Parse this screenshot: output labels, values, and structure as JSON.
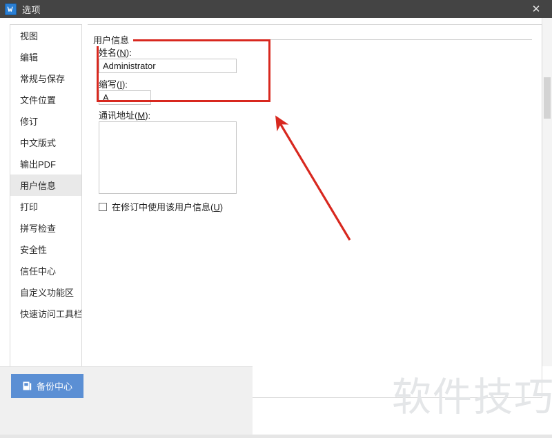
{
  "window": {
    "title": "选项",
    "app_icon": "wps-writer-icon",
    "close_label": "✕"
  },
  "sidebar": {
    "items": [
      {
        "label": "视图",
        "active": false
      },
      {
        "label": "编辑",
        "active": false
      },
      {
        "label": "常规与保存",
        "active": false
      },
      {
        "label": "文件位置",
        "active": false
      },
      {
        "label": "修订",
        "active": false
      },
      {
        "label": "中文版式",
        "active": false
      },
      {
        "label": "输出PDF",
        "active": false
      },
      {
        "label": "用户信息",
        "active": true
      },
      {
        "label": "打印",
        "active": false
      },
      {
        "label": "拼写检查",
        "active": false
      },
      {
        "label": "安全性",
        "active": false
      },
      {
        "label": "信任中心",
        "active": false
      },
      {
        "label": "自定义功能区",
        "active": false
      },
      {
        "label": "快速访问工具栏",
        "active": false
      }
    ]
  },
  "content": {
    "group_title": "用户信息",
    "name_label_prefix": "姓名(",
    "name_label_key": "N",
    "name_label_suffix": "):",
    "name_value": "Administrator",
    "initials_label_prefix": "缩写(",
    "initials_label_key": "I",
    "initials_label_suffix": "):",
    "initials_value": "A",
    "address_label_prefix": "通讯地址(",
    "address_label_key": "M",
    "address_label_suffix": "):",
    "address_value": "",
    "use_in_revisions_prefix": "在修订中使用该用户信息(",
    "use_in_revisions_key": "U",
    "use_in_revisions_suffix": ")",
    "use_in_revisions_checked": false
  },
  "footer": {
    "backup_button_label": "备份中心",
    "backup_button_icon": "backup-center-icon"
  },
  "watermark": {
    "text": "软件技巧"
  },
  "annotations": {
    "highlight_box_name": "user-name-fields-highlight",
    "arrow_name": "pointer-arrow"
  },
  "colors": {
    "titlebar": "#444444",
    "accent": "#5b8fd4",
    "annotation_red": "#d8281f",
    "selected_nav": "#e9e9e9",
    "watermark": "#e4e6e8"
  }
}
